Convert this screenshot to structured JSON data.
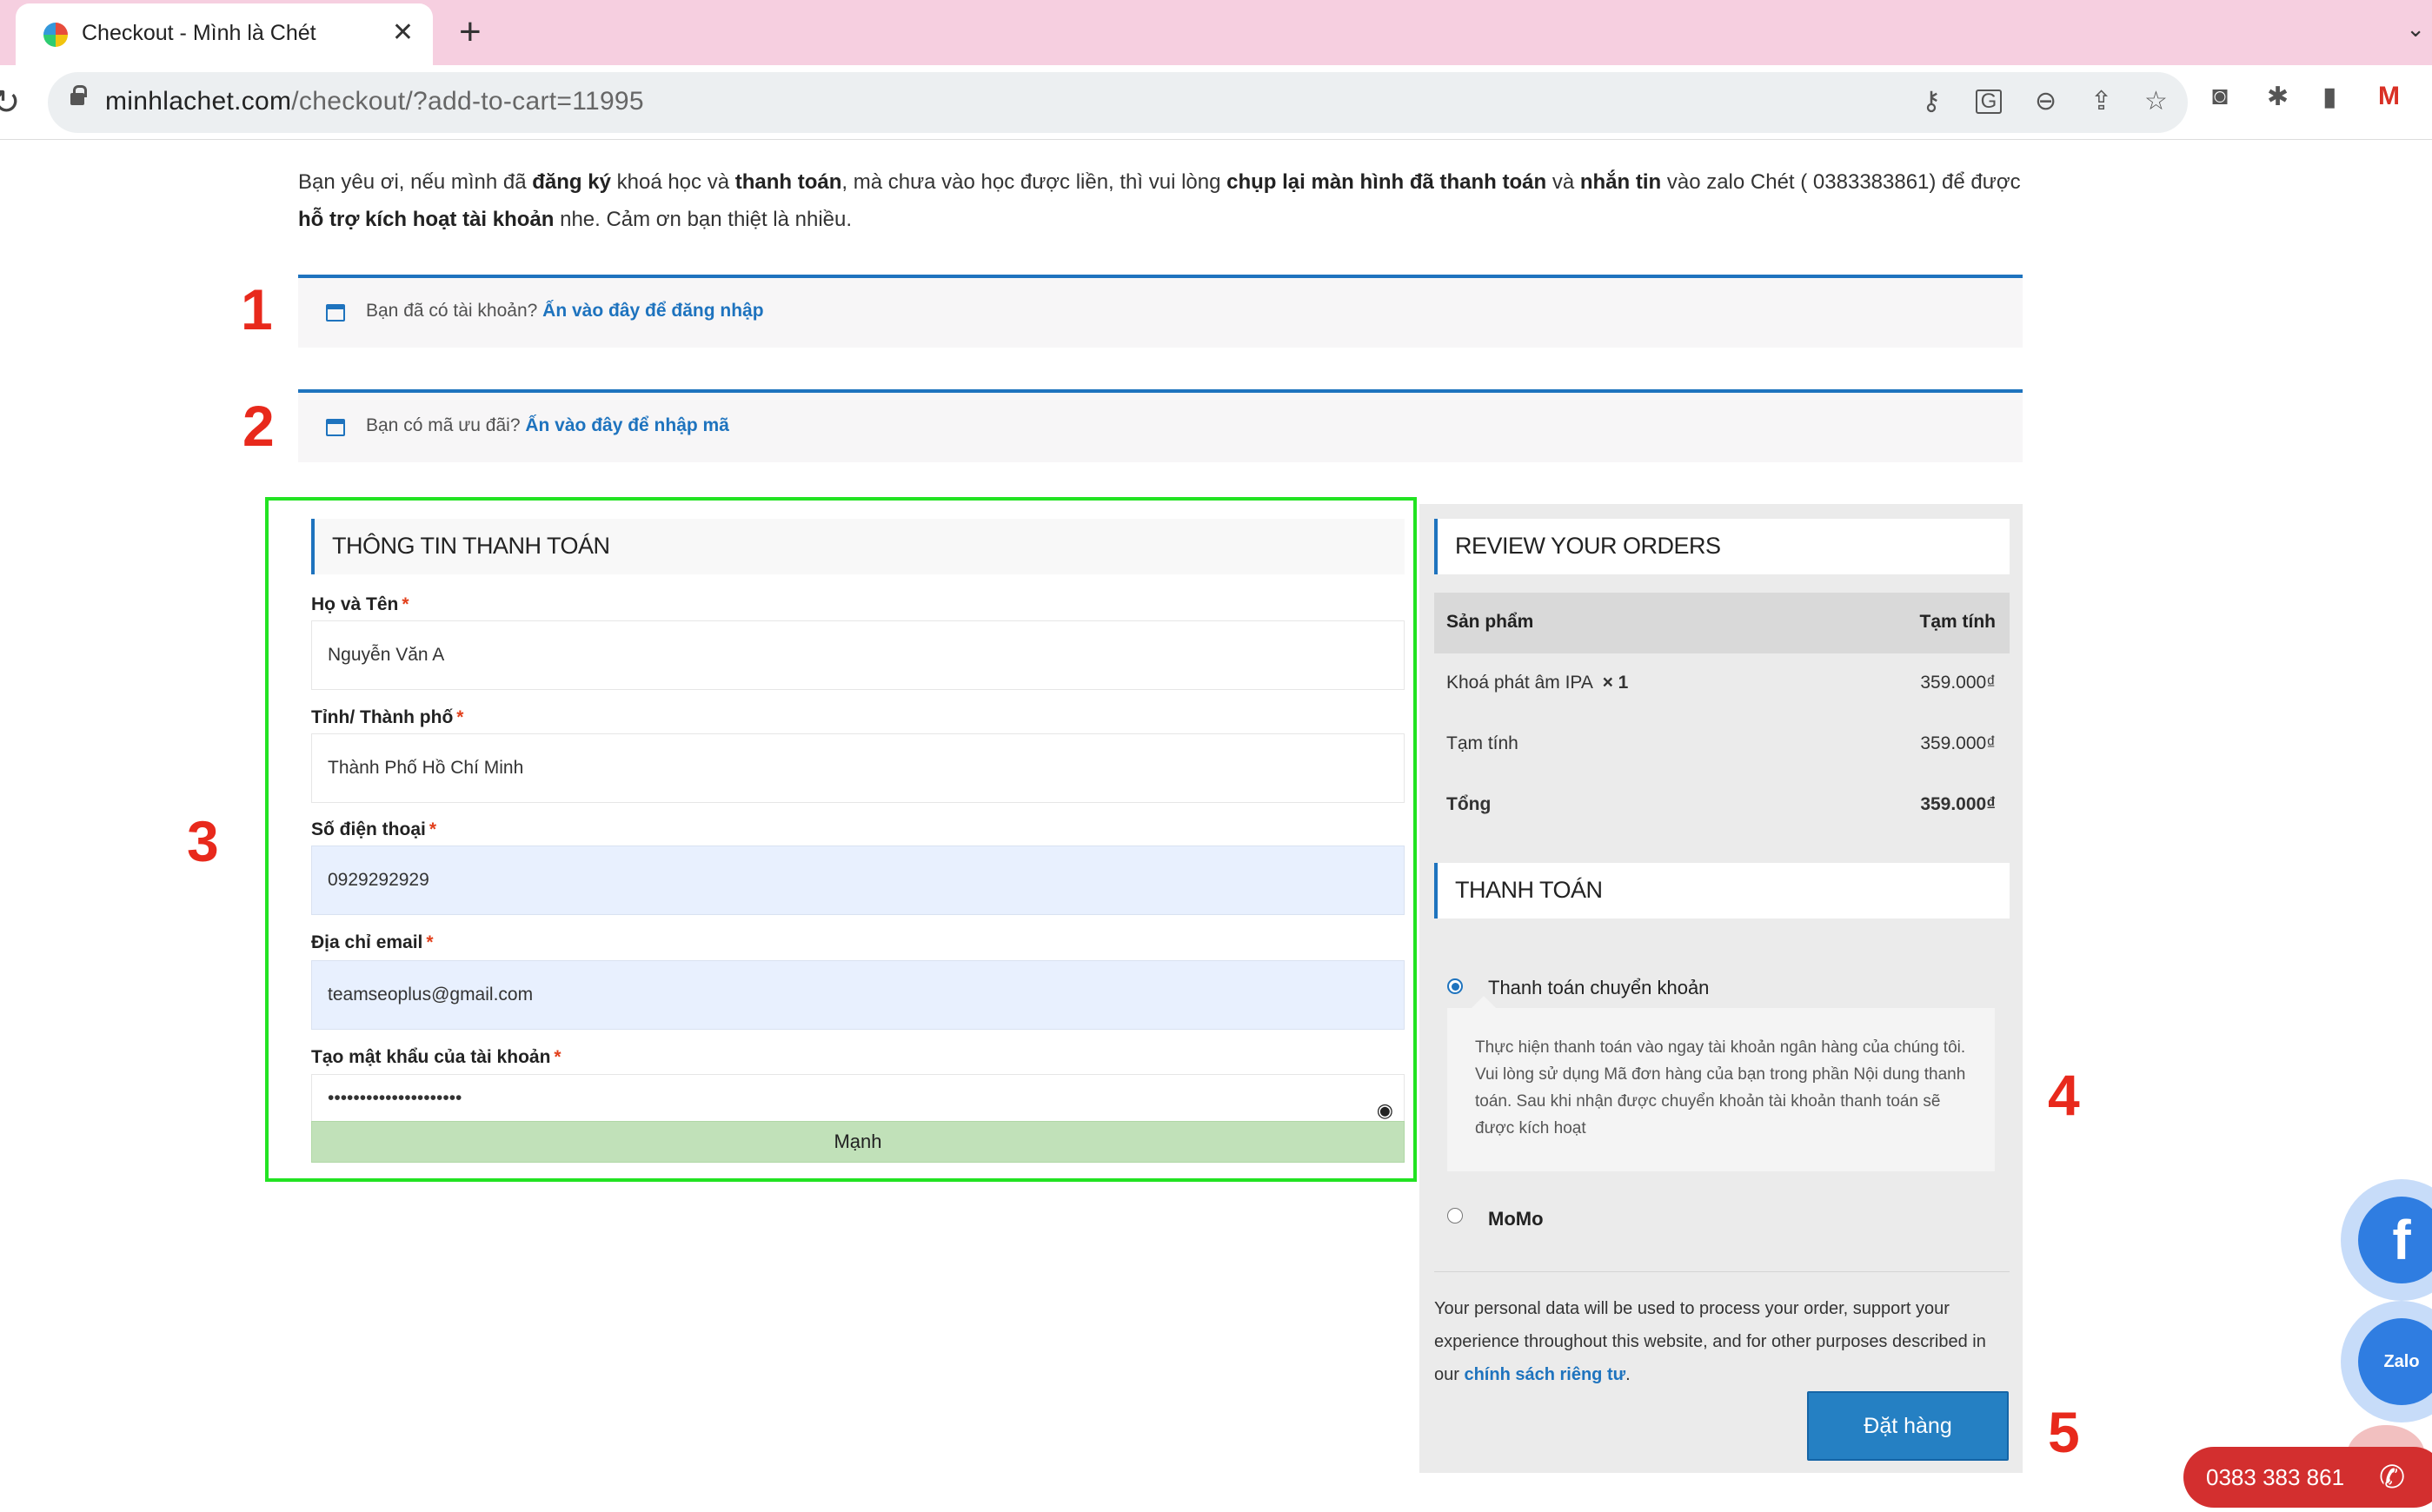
{
  "browser": {
    "tab_title": "Checkout - Mình là Chét",
    "tab_close": "✕",
    "new_tab": "+",
    "url_domain": "minhlachet.com",
    "url_path": "/checkout/?add-to-cart=11995"
  },
  "notice": {
    "t1": "Bạn yêu ơi, nếu mình đã ",
    "b1": "đăng ký",
    "t2": " khoá học và ",
    "b2": "thanh toán",
    "t3": ", mà chưa vào học được liền, thì vui lòng ",
    "b3": "chụp lại màn hình đã thanh toán",
    "t4": " và ",
    "b4": "nhắn tin",
    "t5": " vào zalo Chét ( 0383383861) để được ",
    "b5": "hỗ trợ kích hoạt tài khoản",
    "t6": " nhe. Cảm ơn bạn thiệt là nhiều."
  },
  "login_notice": {
    "text": "Bạn đã có tài khoản? ",
    "link": "Ấn vào đây để đăng nhập"
  },
  "coupon_notice": {
    "text": "Bạn có mã ưu đãi? ",
    "link": "Ấn vào đây để nhập mã"
  },
  "annotations": [
    "1",
    "2",
    "3",
    "4",
    "5"
  ],
  "billing": {
    "heading": "THÔNG TIN THANH TOÁN",
    "required_mark": "*",
    "fields": [
      {
        "label": "Họ và Tên",
        "value": "Nguyễn Văn A"
      },
      {
        "label": "Tỉnh/ Thành phố",
        "value": "Thành Phố Hồ Chí Minh"
      },
      {
        "label": "Số điện thoại",
        "value": "0929292929"
      },
      {
        "label": "Địa chỉ email",
        "value": "teamseoplus@gmail.com"
      },
      {
        "label": "Tạo mật khẩu của tài khoản",
        "value": "•••••••••••••••••••••"
      }
    ],
    "password_strength": "Mạnh"
  },
  "review": {
    "heading": "REVIEW YOUR ORDERS",
    "col_product": "Sản phẩm",
    "col_subtotal": "Tạm tính",
    "item_name": "Khoá phát âm IPA",
    "item_qty": "× 1",
    "item_price": "359.000₫",
    "subtotal_label": "Tạm tính",
    "subtotal_value": "359.000₫",
    "total_label": "Tổng",
    "total_value": "359.000₫"
  },
  "payment": {
    "heading": "THANH TOÁN",
    "method1": "Thanh toán chuyển khoản",
    "method1_desc": "Thực hiện thanh toán vào ngay tài khoản ngân hàng của chúng tôi. Vui lòng sử dụng Mã đơn hàng của bạn trong phần Nội dung thanh toán. Sau khi nhận được chuyển khoản tài khoản thanh toán sẽ được kích hoạt",
    "method2": "MoMo",
    "privacy_text": "Your personal data will be used to process your order, support your experience throughout this website, and for other purposes described in our ",
    "privacy_link": "chính sách riêng tư",
    "privacy_end": ".",
    "place_order": "Đặt hàng"
  },
  "floating": {
    "phone": "0383 383 861",
    "zalo": "Zalo"
  }
}
